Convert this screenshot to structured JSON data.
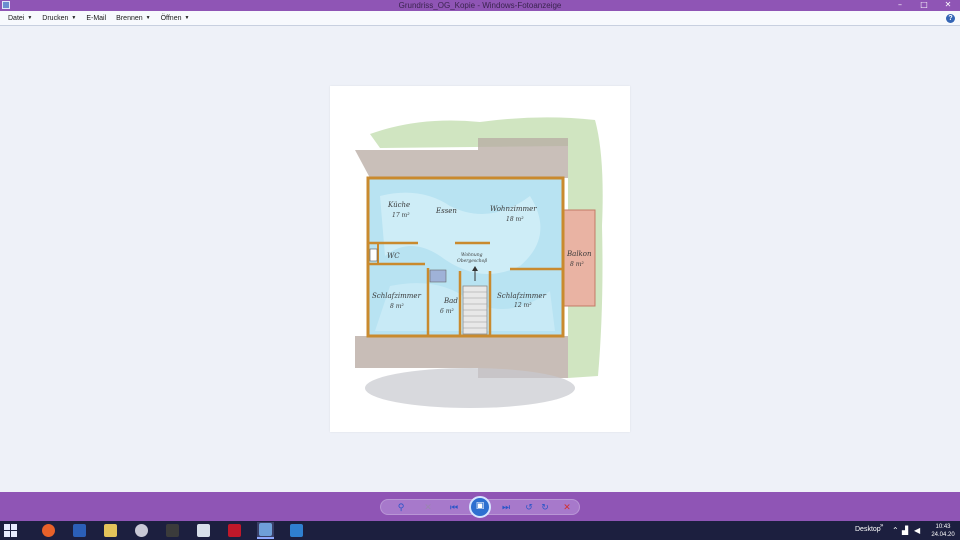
{
  "window": {
    "title": "Grundriss_OG_Kopie - Windows-Fotoanzeige",
    "minimize_glyph": "–",
    "maximize_glyph": "□",
    "close_glyph": "✕"
  },
  "menu": {
    "items": [
      {
        "label": "Datei",
        "has_dropdown": true
      },
      {
        "label": "Drucken",
        "has_dropdown": true
      },
      {
        "label": "E-Mail",
        "has_dropdown": false
      },
      {
        "label": "Brennen",
        "has_dropdown": true
      },
      {
        "label": "Öffnen",
        "has_dropdown": true
      }
    ],
    "caret": "▼",
    "help_glyph": "?"
  },
  "floorplan": {
    "rooms": {
      "kueche": {
        "name": "Küche",
        "area": "17 m²"
      },
      "essen": {
        "name": "Essen"
      },
      "wohnzimmer": {
        "name": "Wohnzimmer",
        "area": "18 m²"
      },
      "balkon": {
        "name": "Balkon",
        "area": "8 m²"
      },
      "wc": {
        "name": "WC"
      },
      "wohnung_og": {
        "name": "Wohnung",
        "sub": "Obergeschoß"
      },
      "schlafzimmer_links": {
        "name": "Schlafzimmer",
        "area": "8 m²"
      },
      "bad": {
        "name": "Bad",
        "area": "6 m²"
      },
      "schlafzimmer_rechts": {
        "name": "Schlafzimmer",
        "area": "12 m²"
      }
    }
  },
  "controls": {
    "zoom_glyph": "⚲",
    "fit_glyph": "✕",
    "prev_glyph": "⏮",
    "slideshow_glyph": "▣",
    "next_glyph": "⏭",
    "rotate_left_glyph": "↺",
    "rotate_right_glyph": "↻",
    "delete_glyph": "✕"
  },
  "taskbar": {
    "desktop_label": "Desktop",
    "chevron": "»",
    "time": "10:43",
    "date": "24.04.20",
    "apps": [
      {
        "name": "firefox",
        "color": "#e8612a"
      },
      {
        "name": "word",
        "color": "#2b5fb8"
      },
      {
        "name": "file-explorer",
        "color": "#e4c35a"
      },
      {
        "name": "paint",
        "color": "#c9c9d6"
      },
      {
        "name": "terminal",
        "color": "#3b3b3b"
      },
      {
        "name": "home-app",
        "color": "#d8e0ea"
      },
      {
        "name": "security-app",
        "color": "#c0182a"
      },
      {
        "name": "photo-viewer",
        "color": "#6f9fd8"
      },
      {
        "name": "remote-desktop",
        "color": "#2f7fd0"
      }
    ]
  }
}
